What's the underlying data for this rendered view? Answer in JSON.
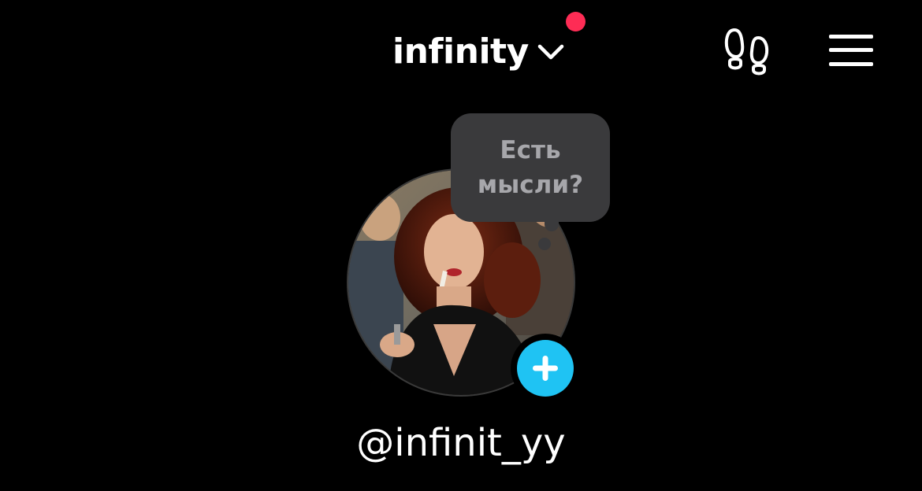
{
  "header": {
    "account_name": "infinity",
    "switch_icon": "chevron-down-icon",
    "notification_color": "#fe2c55",
    "footprint_icon": "footprints-icon",
    "menu_icon": "hamburger-menu-icon"
  },
  "profile": {
    "note_prompt": "Есть\nмысли?",
    "add_icon": "plus-icon",
    "add_color": "#1fc3f3",
    "username": "@infinit_yy"
  }
}
